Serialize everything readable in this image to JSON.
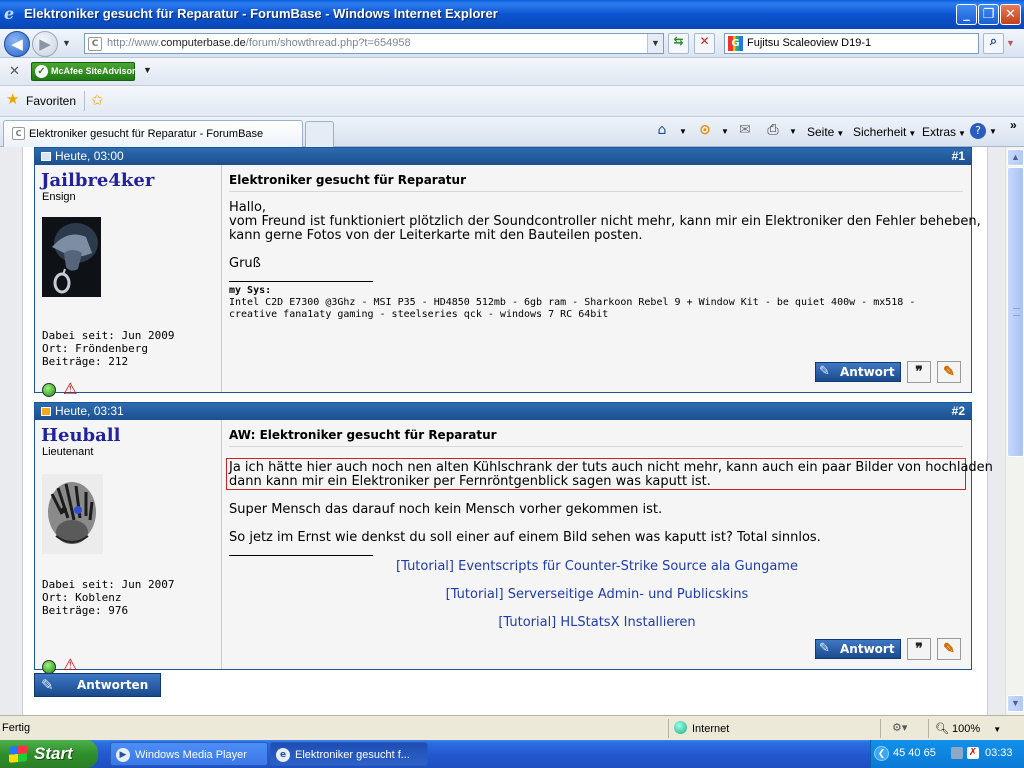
{
  "window": {
    "title": "Elektroniker gesucht für Reparatur - ForumBase - Windows Internet Explorer",
    "minimize": "_",
    "maximize": "❐",
    "close": "✕"
  },
  "address": {
    "url_prefix": "http://www.",
    "url_domain": "computerbase.de",
    "url_rest": "/forum/showthread.php?t=654958",
    "search_value": "Fujitsu Scaleoview D19-1"
  },
  "toolbar": {
    "mcafee_label": "McAfee SiteAdvisor"
  },
  "favorites": {
    "label": "Favoriten"
  },
  "tabs": [
    {
      "label": "Elektroniker gesucht für Reparatur - ForumBase"
    }
  ],
  "commands": {
    "page": "Seite",
    "security": "Sicherheit",
    "extras": "Extras"
  },
  "posts": [
    {
      "date": "Heute, 03:00",
      "number": "#1",
      "username": "Jailbre4ker",
      "rank": "Ensign",
      "joined": "Dabei seit: Jun 2009",
      "location": "Ort: Fröndenberg",
      "posts_count": "Beiträge: 212",
      "title": "Elektroniker gesucht für Reparatur",
      "body": [
        "Hallo,",
        "vom Freund ist funktioniert plötzlich der Soundcontroller nicht mehr, kann mir ein Elektroniker den Fehler beheben,",
        "kann gerne Fotos von der Leiterkarte mit den Bauteilen posten.",
        "Gruß"
      ],
      "sig_title": "my Sys:",
      "sig_lines": [
        "Intel C2D E7300 @3Ghz - MSI P35 - HD4850 512mb - 6gb ram - Sharkoon Rebel 9 + Window Kit - be quiet 400w - mx518 -",
        "creative fana1aty gaming - steelseries qck - windows 7 RC 64bit"
      ],
      "reply_label": "Antwort"
    },
    {
      "date": "Heute, 03:31",
      "number": "#2",
      "username": "Heuball",
      "rank": "Lieutenant",
      "joined": "Dabei seit: Jun 2007",
      "location": "Ort: Koblenz",
      "posts_count": "Beiträge: 976",
      "title": "AW: Elektroniker gesucht für Reparatur",
      "quote_lines": [
        "Ja ich hätte hier auch noch nen alten Kühlschrank der tuts auch nicht mehr, kann auch ein paar Bilder von hochladen",
        "dann kann mir ein Elektroniker per Fernröntgenblick sagen was kaputt ist."
      ],
      "body": [
        "Super Mensch das darauf noch kein Mensch vorher gekommen ist.",
        "So jetz im Ernst wie denkst du soll einer auf einem Bild sehen was kaputt ist? Total sinnlos."
      ],
      "sig_links": [
        "[Tutorial] Eventscripts für Counter-Strike Source ala Gungame",
        "[Tutorial] Serverseitige Admin- und Publicskins",
        "[Tutorial] HLStatsX Installieren"
      ],
      "reply_label": "Antwort"
    }
  ],
  "page_actions": {
    "reply_button": "Antworten"
  },
  "status": {
    "text": "Fertig",
    "zone": "Internet",
    "zoom": "100%"
  },
  "taskbar": {
    "start": "Start",
    "tasks": [
      {
        "label": "Windows Media Player"
      },
      {
        "label": "Elektroniker gesucht f..."
      }
    ],
    "tray_numbers": "45  40  65",
    "clock": "03:33"
  },
  "colors": {
    "post_header": "#1b4f8e",
    "username": "#22229c",
    "link": "#1f3ca8",
    "quote_border": "#cc2222"
  }
}
